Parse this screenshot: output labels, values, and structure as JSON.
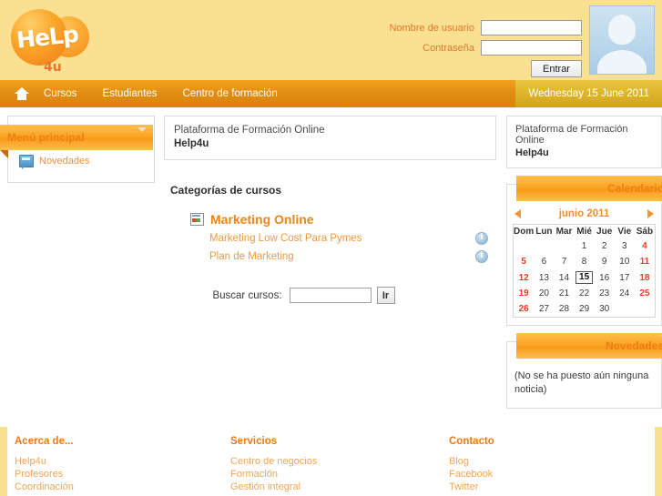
{
  "site": {
    "logo_text": "HeLp",
    "logo_sub": "4u"
  },
  "login": {
    "username_label": "Nombre de usuario",
    "password_label": "Contraseña",
    "username_value": "",
    "password_value": "",
    "submit_label": "Entrar"
  },
  "nav": {
    "home_icon": "home-icon",
    "items": [
      {
        "label": "Cursos"
      },
      {
        "label": "Estudiantes"
      },
      {
        "label": "Centro de formación"
      }
    ],
    "date": "Wednesday 15 June 2011"
  },
  "sidebar_left": {
    "block_title": "Menú principal",
    "items": [
      {
        "label": "Novedades",
        "icon": "news-icon"
      }
    ]
  },
  "main": {
    "site_description_line1": "Plataforma de Formación Online",
    "site_description_line2": "Help4u",
    "categories_heading": "Categorías de cursos",
    "categories": [
      {
        "name": "Marketing Online",
        "icon": "category-icon",
        "courses": [
          {
            "name": "Marketing Low Cost Para Pymes",
            "info_icon": "info-icon"
          },
          {
            "name": "Plan de Marketing",
            "info_icon": "info-icon"
          }
        ]
      }
    ],
    "search_label": "Buscar cursos:",
    "search_value": "",
    "search_button": "Ir"
  },
  "sidebar_right": {
    "description_line1": "Plataforma de Formación Online",
    "description_line2": "Help4u",
    "calendar": {
      "title": "Calendario",
      "month_label": "junio 2011",
      "prev_icon": "arrow-left-icon",
      "next_icon": "arrow-right-icon",
      "weekday_headers": [
        "Dom",
        "Lun",
        "Mar",
        "Mié",
        "Jue",
        "Vie",
        "Sáb"
      ],
      "weeks": [
        [
          {
            "d": "",
            "t": "blank"
          },
          {
            "d": "",
            "t": "blank"
          },
          {
            "d": "",
            "t": "blank"
          },
          {
            "d": "1",
            "t": "day"
          },
          {
            "d": "2",
            "t": "day"
          },
          {
            "d": "3",
            "t": "day"
          },
          {
            "d": "4",
            "t": "weekend"
          }
        ],
        [
          {
            "d": "5",
            "t": "weekend"
          },
          {
            "d": "6",
            "t": "day"
          },
          {
            "d": "7",
            "t": "day"
          },
          {
            "d": "8",
            "t": "day"
          },
          {
            "d": "9",
            "t": "day"
          },
          {
            "d": "10",
            "t": "day"
          },
          {
            "d": "11",
            "t": "weekend"
          }
        ],
        [
          {
            "d": "12",
            "t": "weekend"
          },
          {
            "d": "13",
            "t": "day"
          },
          {
            "d": "14",
            "t": "day"
          },
          {
            "d": "15",
            "t": "today"
          },
          {
            "d": "16",
            "t": "day"
          },
          {
            "d": "17",
            "t": "day"
          },
          {
            "d": "18",
            "t": "weekend"
          }
        ],
        [
          {
            "d": "19",
            "t": "weekend"
          },
          {
            "d": "20",
            "t": "day"
          },
          {
            "d": "21",
            "t": "day"
          },
          {
            "d": "22",
            "t": "day"
          },
          {
            "d": "23",
            "t": "day"
          },
          {
            "d": "24",
            "t": "day"
          },
          {
            "d": "25",
            "t": "weekend"
          }
        ],
        [
          {
            "d": "26",
            "t": "weekend"
          },
          {
            "d": "27",
            "t": "day"
          },
          {
            "d": "28",
            "t": "day"
          },
          {
            "d": "29",
            "t": "day"
          },
          {
            "d": "30",
            "t": "day"
          },
          {
            "d": "",
            "t": "blank"
          },
          {
            "d": "",
            "t": "blank"
          }
        ]
      ]
    },
    "news": {
      "title": "Novedades",
      "empty_text": "(No se ha puesto aún ninguna noticia)"
    }
  },
  "footer": {
    "columns": [
      {
        "title": "Acerca de...",
        "links": [
          {
            "label": "Help4u"
          },
          {
            "label": "Profesores"
          },
          {
            "label": "Coordinación"
          }
        ]
      },
      {
        "title": "Servicios",
        "links": [
          {
            "label": "Centro de negocios"
          },
          {
            "label": "Formación"
          },
          {
            "label": "Gestión integral"
          }
        ]
      },
      {
        "title": "Contacto",
        "links": [
          {
            "label": "Blog"
          },
          {
            "label": "Facebook"
          },
          {
            "label": "Twitter"
          }
        ]
      }
    ]
  },
  "colors": {
    "page_background": "#fbe092",
    "nav_orange": "#e08c13",
    "accent_orange": "#ef7a12",
    "link_orange": "#f2993e",
    "date_gold": "#ddb229",
    "weekend_red": "#f03a22"
  }
}
